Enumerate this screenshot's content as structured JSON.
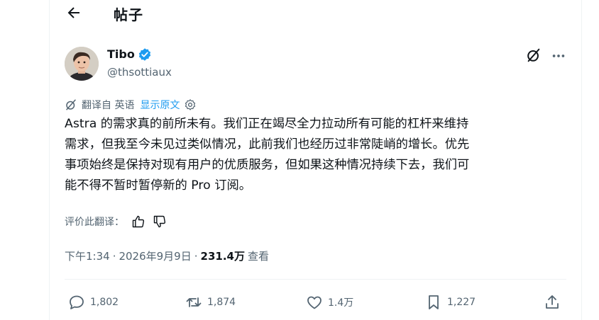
{
  "header": {
    "title": "帖子"
  },
  "author": {
    "name": "Tibo",
    "handle": "@thsottiaux"
  },
  "translation": {
    "label": "翻译自 英语",
    "show_original": "显示原文"
  },
  "post": {
    "text": "Astra 的需求真的前所未有。我们正在竭尽全力拉动所有可能的杠杆来维持\n需求，但我至今未见过类似情况，此前我们也经历过非常陡峭的增长。优先\n事项始终是保持对现有用户的优质服务，但如果这种情况持续下去，我们可\n能不得不暂时暂停新的 Pro 订阅。"
  },
  "rating": {
    "label": "评价此翻译："
  },
  "meta": {
    "time": "下午1:34",
    "sep1": "·",
    "date": "2026年9月9日",
    "sep2": "·",
    "views": "231.4万",
    "views_label": "查看"
  },
  "actions": {
    "replies": "1,802",
    "reposts": "1,874",
    "likes": "1.4万",
    "bookmarks": "1,227"
  },
  "colors": {
    "accent": "#1d9bf0",
    "text": "#0f1419",
    "muted": "#536471",
    "border": "#eff3f4"
  },
  "icons": [
    "arrow-left-icon",
    "verified-badge-icon",
    "grok-icon",
    "more-icon",
    "translate-icon",
    "gear-icon",
    "thumbs-up-icon",
    "thumbs-down-icon",
    "reply-icon",
    "repost-icon",
    "like-icon",
    "bookmark-icon",
    "share-icon"
  ]
}
